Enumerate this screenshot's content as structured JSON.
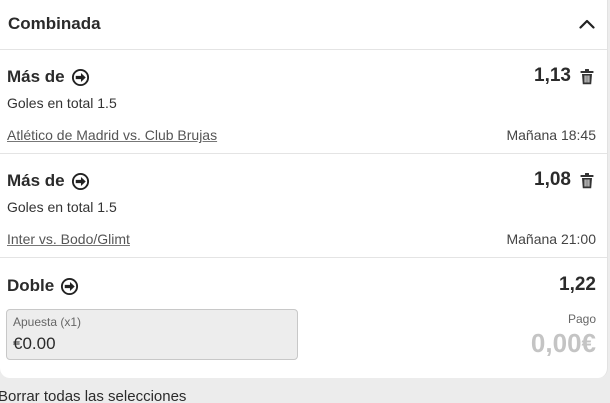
{
  "header": {
    "title": "Combinada",
    "collapse_icon": "chevron-up-icon"
  },
  "selections": [
    {
      "type": "Más de",
      "market": "Goles en total 1.5",
      "event": "Atlético de Madrid vs. Club Brujas",
      "time": "Mañana 18:45",
      "odds": "1,13"
    },
    {
      "type": "Más de",
      "market": "Goles en total 1.5",
      "event": "Inter vs. Bodo/Glimt",
      "time": "Mañana 21:00",
      "odds": "1,08"
    }
  ],
  "bet": {
    "type": "Doble",
    "odds": "1,22",
    "stake_label": "Apuesta (x1)",
    "stake_value": "€0.00",
    "payout_label": "Pago",
    "payout_value": "0,00€"
  },
  "footer": {
    "clear_all_label": "Borrar todas las selecciones"
  },
  "colors": {
    "text": "#2b2b2b",
    "muted_payout": "#c4c4c4",
    "input_bg": "#ededed",
    "page_bg": "#ececec"
  }
}
